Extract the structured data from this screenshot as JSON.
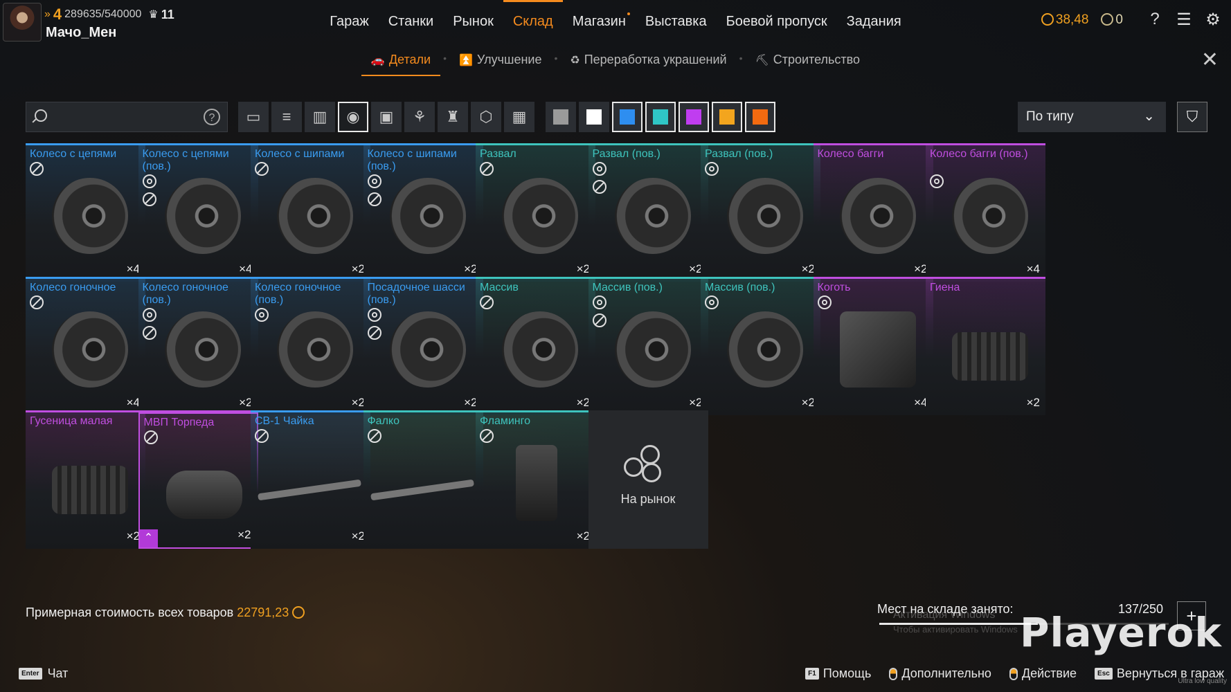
{
  "player": {
    "level": "4",
    "xp": "289635/540000",
    "clan_rank": "11",
    "name": "Мачо_Мен"
  },
  "nav": {
    "items": [
      {
        "label": "Гараж"
      },
      {
        "label": "Станки"
      },
      {
        "label": "Рынок"
      },
      {
        "label": "Склад",
        "active": true
      },
      {
        "label": "Магазин",
        "dot": true
      },
      {
        "label": "Выставка"
      },
      {
        "label": "Боевой пропуск"
      },
      {
        "label": "Задания"
      }
    ]
  },
  "currency": {
    "coins": "38,48",
    "other": "0"
  },
  "subnav": {
    "items": [
      {
        "label": "Детали",
        "icon": "car-icon",
        "active": true
      },
      {
        "label": "Улучшение",
        "icon": "chevrons-up-icon"
      },
      {
        "label": "Переработка украшений",
        "icon": "recycle-icon"
      },
      {
        "label": "Строительство",
        "icon": "build-icon"
      }
    ]
  },
  "search": {
    "placeholder": "",
    "help": "?"
  },
  "type_filters": [
    {
      "name": "cabin-filter",
      "glyph": "▭"
    },
    {
      "name": "weapon-filter",
      "glyph": "≡"
    },
    {
      "name": "module-filter",
      "glyph": "▥"
    },
    {
      "name": "wheel-filter",
      "glyph": "◉",
      "active": true
    },
    {
      "name": "frame-filter",
      "glyph": "▣"
    },
    {
      "name": "drone-filter",
      "glyph": "⚘"
    },
    {
      "name": "decor-filter",
      "glyph": "♜"
    },
    {
      "name": "part-filter",
      "glyph": "⬡"
    },
    {
      "name": "grid-filter",
      "glyph": "▦"
    }
  ],
  "color_filters": [
    {
      "color": "#9a9a9a"
    },
    {
      "color": "#ffffff"
    },
    {
      "color": "#2e8ef0",
      "active": true
    },
    {
      "color": "#2fc6c6",
      "active": true
    },
    {
      "color": "#c03df0",
      "active": true
    },
    {
      "color": "#f3a51e",
      "active": true
    },
    {
      "color": "#f26a10",
      "active": true
    }
  ],
  "sort": {
    "label": "По типу"
  },
  "items": [
    {
      "name": "Колесо с цепями",
      "qty": "×4",
      "rarity": "rare",
      "badges": [
        "no"
      ],
      "img": "wheel"
    },
    {
      "name": "Колесо с цепями (пов.)",
      "qty": "×4",
      "rarity": "rare",
      "badges": [
        "wheel",
        "no"
      ],
      "img": "wheel"
    },
    {
      "name": "Колесо с шипами",
      "qty": "×2",
      "rarity": "rare",
      "badges": [
        "no"
      ],
      "img": "wheel"
    },
    {
      "name": "Колесо с шипами (пов.)",
      "qty": "×2",
      "rarity": "rare",
      "badges": [
        "wheel",
        "no"
      ],
      "img": "wheel"
    },
    {
      "name": "Развал",
      "qty": "×2",
      "rarity": "special",
      "badges": [
        "no"
      ],
      "img": "wheel"
    },
    {
      "name": "Развал (пов.)",
      "qty": "×2",
      "rarity": "special",
      "badges": [
        "wheel",
        "no"
      ],
      "img": "wheel"
    },
    {
      "name": "Развал (пов.)",
      "qty": "×2",
      "rarity": "special",
      "badges": [
        "wheel"
      ],
      "img": "wheel"
    },
    {
      "name": "Колесо багги",
      "qty": "×2",
      "rarity": "epic",
      "badges": [],
      "img": "wheel"
    },
    {
      "name": "Колесо багги (пов.)",
      "qty": "×4",
      "rarity": "epic",
      "badges": [
        "wheel"
      ],
      "img": "wheel"
    },
    {
      "name": "Колесо гоночное",
      "qty": "×4",
      "rarity": "rare",
      "badges": [
        "no"
      ],
      "img": "wheel"
    },
    {
      "name": "Колесо гоночное (пов.)",
      "qty": "×2",
      "rarity": "rare",
      "badges": [
        "wheel",
        "no"
      ],
      "img": "wheel"
    },
    {
      "name": "Колесо гоночное (пов.)",
      "qty": "×2",
      "rarity": "rare",
      "badges": [
        "wheel"
      ],
      "img": "wheel"
    },
    {
      "name": "Посадочное шасси (пов.)",
      "qty": "×2",
      "rarity": "rare",
      "badges": [
        "wheel",
        "no"
      ],
      "img": "wheel"
    },
    {
      "name": "Массив",
      "qty": "×2",
      "rarity": "special",
      "badges": [
        "no"
      ],
      "img": "wheel"
    },
    {
      "name": "Массив (пов.)",
      "qty": "×2",
      "rarity": "special",
      "badges": [
        "wheel",
        "no"
      ],
      "img": "wheel"
    },
    {
      "name": "Массив (пов.)",
      "qty": "×2",
      "rarity": "special",
      "badges": [
        "wheel"
      ],
      "img": "wheel"
    },
    {
      "name": "Коготь",
      "qty": "×4",
      "rarity": "epic",
      "badges": [
        "wheel"
      ],
      "img": "crane"
    },
    {
      "name": "Гиена",
      "qty": "×2",
      "rarity": "epic",
      "badges": [],
      "img": "track"
    },
    {
      "name": "Гусеница малая",
      "qty": "×2",
      "rarity": "epic",
      "badges": [],
      "img": "track"
    },
    {
      "name": "МВП Торпеда",
      "qty": "×2",
      "rarity": "epic",
      "badges": [
        "no"
      ],
      "img": "hover",
      "selected": true,
      "upgrade": true
    },
    {
      "name": "СВ-1 Чайка",
      "qty": "×2",
      "rarity": "rare",
      "badges": [
        "no"
      ],
      "img": "rotor"
    },
    {
      "name": "Фалко",
      "qty": "",
      "rarity": "special",
      "badges": [
        "no"
      ],
      "img": "rotor"
    },
    {
      "name": "Фламинго",
      "qty": "×2",
      "rarity": "special",
      "badges": [
        "no"
      ],
      "img": "robot"
    }
  ],
  "market_tile": {
    "label": "На рынок"
  },
  "rarity_colors": {
    "rare": "#3a9cf0",
    "special": "#3ec4bd",
    "epic": "#c04ee0"
  },
  "footer": {
    "total_label": "Примерная стоимость всех товаров",
    "total_value": "22791,23",
    "storage_label": "Мест на складе занято:",
    "storage_count": "137/250",
    "storage_fraction": 0.548,
    "watermark": "Playerok",
    "win_activation": "Активация Windows",
    "win_activation_sub": "Чтобы активировать Windows",
    "chat_key": "Enter",
    "chat_label": "Чат",
    "actions": [
      {
        "key": "F1",
        "label": "Помощь",
        "type": "key"
      },
      {
        "label": "Дополнительно",
        "type": "mouse"
      },
      {
        "label": "Действие",
        "type": "mouse"
      },
      {
        "key": "Esc",
        "label": "Вернуться в гараж",
        "type": "key"
      }
    ],
    "quality_note": "Ultra low quality"
  }
}
